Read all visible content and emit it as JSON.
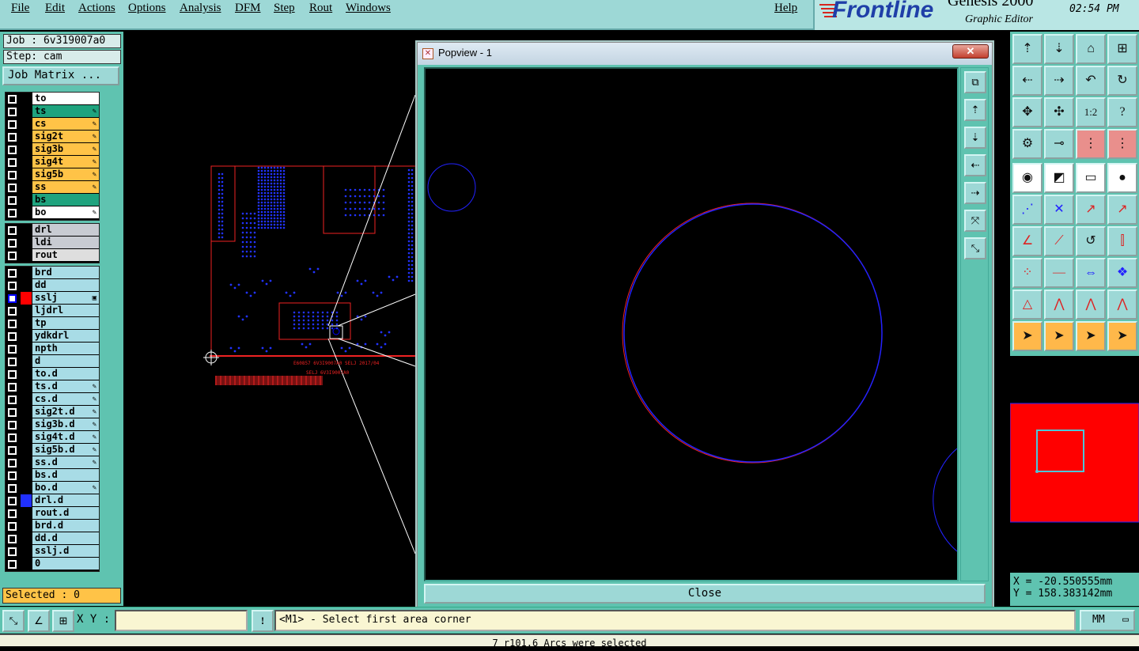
{
  "menu": {
    "items": [
      "File",
      "Edit",
      "Actions",
      "Options",
      "Analysis",
      "DFM",
      "Step",
      "Rout",
      "Windows"
    ],
    "help": "Help"
  },
  "brand": {
    "logo": "Frontline",
    "product": "Genesis 2000",
    "subtitle": "Graphic Editor",
    "time": "02:54 PM"
  },
  "job": {
    "job_line": "Job : 6v319007a0",
    "step_line": "Step: cam",
    "matrix_button": "Job Matrix ..."
  },
  "layers": {
    "group1": [
      {
        "name": "to",
        "bg": "#ffffff",
        "edit": false
      },
      {
        "name": "ts",
        "bg": "#1fa37e",
        "edit": true
      },
      {
        "name": "cs",
        "bg": "#ffc347",
        "edit": true
      },
      {
        "name": "sig2t",
        "bg": "#ffc347",
        "edit": true
      },
      {
        "name": "sig3b",
        "bg": "#ffc347",
        "edit": true
      },
      {
        "name": "sig4t",
        "bg": "#ffc347",
        "edit": true
      },
      {
        "name": "sig5b",
        "bg": "#ffc347",
        "edit": true
      },
      {
        "name": "ss",
        "bg": "#ffc347",
        "edit": true
      },
      {
        "name": "bs",
        "bg": "#1fa37e",
        "edit": false
      },
      {
        "name": "bo",
        "bg": "#ffffff",
        "edit": true
      }
    ],
    "group2": [
      {
        "name": "drl",
        "bg": "#c8cbd2",
        "edit": false
      },
      {
        "name": "ldi",
        "bg": "#c8cbd2",
        "edit": false
      },
      {
        "name": "rout",
        "bg": "#dedede",
        "edit": false
      }
    ],
    "group3": [
      {
        "name": "brd",
        "bg": "#a8dce6",
        "edit": false
      },
      {
        "name": "dd",
        "bg": "#a8dce6",
        "edit": false
      },
      {
        "name": "sslj",
        "bg": "#a8dce6",
        "edit": false,
        "selected": true,
        "swatch": "#ff0000",
        "mark": "▣"
      },
      {
        "name": "ljdrl",
        "bg": "#a8dce6",
        "edit": false
      },
      {
        "name": "tp",
        "bg": "#a8dce6",
        "edit": false
      },
      {
        "name": "ydkdrl",
        "bg": "#a8dce6",
        "edit": false
      },
      {
        "name": "npth",
        "bg": "#a8dce6",
        "edit": false
      },
      {
        "name": "d",
        "bg": "#a8dce6",
        "edit": false
      },
      {
        "name": "to.d",
        "bg": "#a8dce6",
        "edit": false
      },
      {
        "name": "ts.d",
        "bg": "#a8dce6",
        "edit": true
      },
      {
        "name": "cs.d",
        "bg": "#a8dce6",
        "edit": true
      },
      {
        "name": "sig2t.d",
        "bg": "#a8dce6",
        "edit": true
      },
      {
        "name": "sig3b.d",
        "bg": "#a8dce6",
        "edit": true
      },
      {
        "name": "sig4t.d",
        "bg": "#a8dce6",
        "edit": true
      },
      {
        "name": "sig5b.d",
        "bg": "#a8dce6",
        "edit": true
      },
      {
        "name": "ss.d",
        "bg": "#a8dce6",
        "edit": true
      },
      {
        "name": "bs.d",
        "bg": "#a8dce6",
        "edit": false
      },
      {
        "name": "bo.d",
        "bg": "#a8dce6",
        "edit": true
      },
      {
        "name": "drl.d",
        "bg": "#a8dce6",
        "edit": false,
        "swatch": "#2030ff"
      },
      {
        "name": "rout.d",
        "bg": "#a8dce6",
        "edit": false
      },
      {
        "name": "brd.d",
        "bg": "#a8dce6",
        "edit": false
      },
      {
        "name": "dd.d",
        "bg": "#a8dce6",
        "edit": false
      },
      {
        "name": "sslj.d",
        "bg": "#a8dce6",
        "edit": false
      },
      {
        "name": "0",
        "bg": "#a8dce6",
        "edit": false
      }
    ]
  },
  "selected_label": "Selected : 0",
  "popview": {
    "title": "Popview - 1",
    "close_x": "✕",
    "close_button": "Close"
  },
  "coords": {
    "x": "X = -20.550555mm",
    "y": "Y = 158.383142mm"
  },
  "bottom": {
    "xy_label": "X Y :",
    "xy_value": "",
    "warn": "!",
    "message": "<M1> - Select first area corner",
    "unit": "MM"
  },
  "status": "7 r101.6 Arcs were selected",
  "board_text": {
    "line1": "E60857 6V3I9007A0 SELJ 2017/04",
    "line2": "SELJ 6V3I9007A0"
  }
}
